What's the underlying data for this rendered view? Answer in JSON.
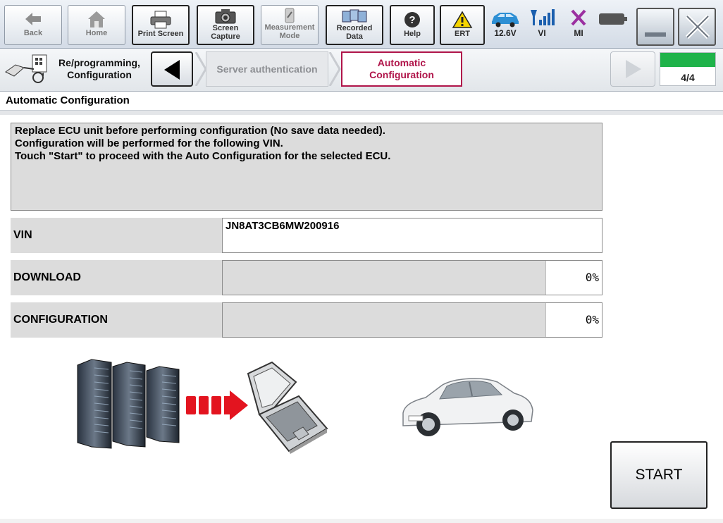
{
  "toolbar": {
    "back": "Back",
    "home": "Home",
    "print_screen": "Print Screen",
    "screen_capture": "Screen\nCapture",
    "measurement_mode": "Measurement\nMode",
    "recorded_data": "Recorded\nData",
    "help": "Help",
    "ert": "ERT",
    "battery_voltage": "12.6V",
    "vi": "VI",
    "mi": "MI"
  },
  "nav": {
    "section": "Re/programming,\nConfiguration",
    "step_inactive": "Server authentication",
    "step_active": "Automatic\nConfiguration",
    "page_counter": "4/4",
    "progress_fraction": 1.0
  },
  "page": {
    "title": "Automatic Configuration",
    "message": [
      "Replace ECU unit before performing configuration (No save data needed).",
      "Configuration will be performed for the following VIN.",
      "Touch \"Start\" to proceed with the Auto Configuration for the selected ECU."
    ],
    "vin_label": "VIN",
    "vin_value": "JN8AT3CB6MW200916",
    "download_label": "DOWNLOAD",
    "download_pct": "0%",
    "download_progress": 0,
    "configuration_label": "CONFIGURATION",
    "configuration_pct": "0%",
    "configuration_progress": 0,
    "start_button": "START"
  },
  "colors": {
    "accent_active_step": "#b0154a",
    "progress_green": "#1fb34a",
    "arrow_red": "#e3141f"
  }
}
